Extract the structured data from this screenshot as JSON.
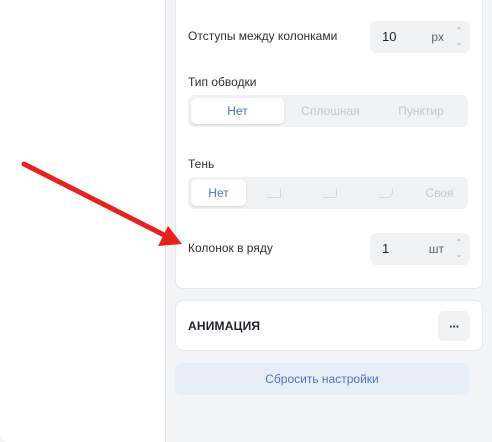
{
  "settings": {
    "column_gap": {
      "label": "Отступы между колонками",
      "value": "10",
      "unit": "px"
    },
    "border_type": {
      "label": "Тип обводки",
      "options": [
        "Нет",
        "Сплошная",
        "Пунктир"
      ],
      "selected": "Нет"
    },
    "shadow": {
      "label": "Тень",
      "options": [
        "Нет",
        "Своя"
      ],
      "selected": "Нет"
    },
    "columns_per_row": {
      "label": "Колонок в ряду",
      "value": "1",
      "unit": "шт"
    }
  },
  "animation": {
    "title": "АНИМАЦИЯ",
    "more_label": "···"
  },
  "reset_button": "Сбросить настройки",
  "colors": {
    "accent": "#4a72c9",
    "arrow": "#e8201e",
    "reset_bg": "#e8eef8"
  }
}
